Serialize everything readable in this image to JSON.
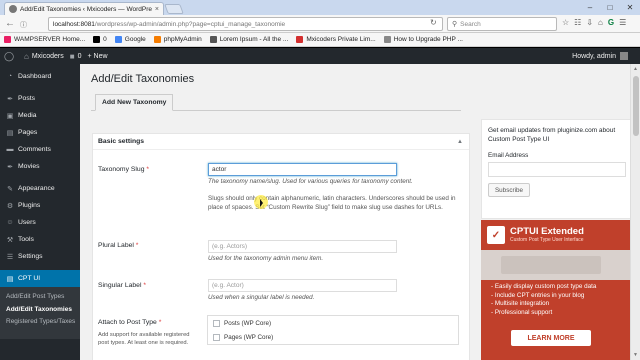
{
  "browser": {
    "tab_title": "Add/Edit Taxonomies ‹ Mxicoders — WordPress",
    "tab_close": "×",
    "url_host": "localhost:8081",
    "url_path": "/wordpress/wp-admin/admin.php?page=cptui_manage_taxonomie",
    "search_placeholder": "Search",
    "bookmarks": [
      {
        "label": "WAMPSERVER Home...",
        "color": "#e91e63"
      },
      {
        "label": "0",
        "color": "#000000"
      },
      {
        "label": "Google",
        "color": "#4285f4"
      },
      {
        "label": "phpMyAdmin",
        "color": "#f57c00"
      },
      {
        "label": "Lorem Ipsum - All the ...",
        "color": "#555555"
      },
      {
        "label": "Mxicoders Private Lim...",
        "color": "#d32f2f"
      },
      {
        "label": "How to Upgrade PHP ...",
        "color": "#888888"
      }
    ]
  },
  "adminbar": {
    "site": "Mxicoders",
    "comments": "0",
    "new": "+ New",
    "greeting": "Howdy, admin"
  },
  "sidebar": {
    "items": [
      {
        "label": "Dashboard",
        "icon": "dashboard-icon",
        "glyph": "◔"
      },
      {
        "label": "Posts",
        "icon": "pin-icon",
        "glyph": "✒"
      },
      {
        "label": "Media",
        "icon": "media-icon",
        "glyph": "▣"
      },
      {
        "label": "Pages",
        "icon": "page-icon",
        "glyph": "▤"
      },
      {
        "label": "Comments",
        "icon": "comment-icon",
        "glyph": "▬"
      },
      {
        "label": "Movies",
        "icon": "pin-icon",
        "glyph": "✒"
      },
      {
        "label": "Appearance",
        "icon": "brush-icon",
        "glyph": "✎"
      },
      {
        "label": "Plugins",
        "icon": "plugin-icon",
        "glyph": "⚙"
      },
      {
        "label": "Users",
        "icon": "user-icon",
        "glyph": "☺"
      },
      {
        "label": "Tools",
        "icon": "wrench-icon",
        "glyph": "⚒"
      },
      {
        "label": "Settings",
        "icon": "settings-icon",
        "glyph": "☰"
      },
      {
        "label": "CPT UI",
        "icon": "cptui-icon",
        "glyph": "▤"
      }
    ],
    "submenu": [
      "Add/Edit Post Types",
      "Add/Edit Taxonomies",
      "Registered Types/Taxes"
    ]
  },
  "main": {
    "title": "Add/Edit Taxonomies",
    "tab": "Add New Taxonomy",
    "panel_title": "Basic settings",
    "slug_label": "Taxonomy Slug",
    "required": "*",
    "slug_value": "actor",
    "slug_desc": "The taxonomy name/slug. Used for various queries for taxonomy content.",
    "slug_note": "Slugs should only contain alphanumeric, latin characters. Underscores should be used in place of spaces. Set “Custom Rewrite Slug” field to make slug use dashes for URLs.",
    "plural_label": "Plural Label",
    "plural_placeholder": "(e.g. Actors)",
    "plural_desc": "Used for the taxonomy admin menu item.",
    "singular_label": "Singular Label",
    "singular_placeholder": "(e.g. Actor)",
    "singular_desc": "Used when a singular label is needed.",
    "attach_label": "Attach to Post Type",
    "attach_desc": "Add support for available registered post types. At least one is required.",
    "post_types": [
      "Posts (WP Core)",
      "Pages (WP Core)"
    ]
  },
  "widget": {
    "text": "Get email updates from pluginize.com about Custom Post Type UI",
    "email_label": "Email Address",
    "subscribe": "Subscribe"
  },
  "ad": {
    "logo": "✓",
    "title": "CPTUI Extended",
    "subtitle": "Custom Post Type User Interface",
    "features": [
      "- Easily display custom post type data",
      "- Include CPT entries in your blog",
      "- Multisite integration",
      "- Professional support"
    ],
    "cta": "LEARN MORE"
  },
  "colors": {
    "admin_dark": "#23282d",
    "admin_blue": "#0073aa",
    "ad_red": "#c0402b"
  }
}
